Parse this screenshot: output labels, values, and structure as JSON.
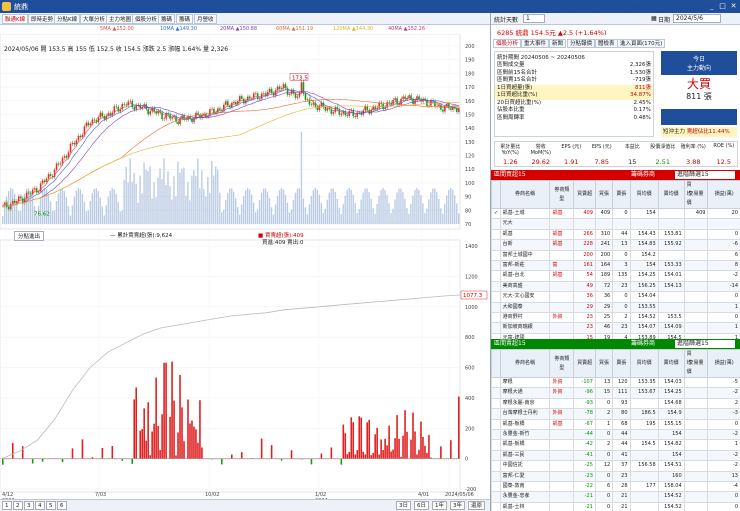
{
  "title": "統鼎",
  "window_buttons": [
    "_",
    "□",
    "✕"
  ],
  "left_tabs": [
    "聯通K線",
    "即時走勢",
    "分點K線",
    "大單分析",
    "主力地圖",
    "個股分析",
    "籌碼",
    "籌碼",
    "月營收"
  ],
  "ma_legend": [
    "5MA ▲152.00",
    "10MA ▲149.30",
    "20MA ▲150.88",
    "60MA ▲151.19",
    "120MA ▲144.30",
    "240MA",
    "40MA ▲152.26"
  ],
  "ma_colors": [
    "#e05050",
    "#3070d0",
    "#8040c0",
    "#e07030",
    "#e0b030",
    "#40a040",
    "#c03080"
  ],
  "price_info": {
    "line1": "2024/05/06 開 153.5 高 155 低 152.5 收 154.5 漲跌 2.5 漲幅 1.64% 量 2,326",
    "price_max_label": "173.5",
    "price_min_label": "76.62",
    "sub_price_label": "1077.3"
  },
  "y_axis_price": [
    "200",
    "190",
    "180",
    "170",
    "160",
    "150",
    "140",
    "130",
    "120",
    "110",
    "100",
    "90",
    "80",
    "70"
  ],
  "y_axis_sub": [
    "1400",
    "1200",
    "1000",
    "800",
    "600",
    "400",
    "200",
    "0",
    "-200"
  ],
  "x_axis": [
    "4/12\n2023",
    "7/03",
    "10/02",
    "1/02\n2024",
    "4/01",
    "2024/05/06"
  ],
  "sub_toolbar": {
    "select": "分點進出",
    "legend1": "— 累計賈賣超(張):9,624",
    "legend2": "■ 賈賣超(張):409",
    "legend3": "買進:409 賣出:0"
  },
  "bottom_pages": [
    "1",
    "2",
    "3",
    "4",
    "5",
    "6"
  ],
  "bottom_periods": [
    "3日",
    "6日",
    "1年",
    "3年",
    "還原"
  ],
  "right_tabs": [
    "統計天數",
    "1",
    "日期",
    "2024/5/6"
  ],
  "top_menu": [
    "手機",
    "報告",
    "籌碼",
    "主力",
    "籌碼",
    "選股資料",
    "交易筆數",
    "助選資料"
  ],
  "stock_header": "6285 統鼎 154.5元 ▲2.5 (+1.64%)",
  "sub_tabs": [
    "個股分析",
    "重大事件",
    "新聞",
    "分點報價",
    "體檢表",
    "進入頁面(170元)"
  ],
  "stats": {
    "period": "統計期間 20240506 ~ 20240506",
    "rows": [
      {
        "label": "區間成交量",
        "value": "2,326張"
      },
      {
        "label": "區間前15名合計",
        "value": "1,530張"
      },
      {
        "label": "區間賣15名合計",
        "value": "-719張"
      },
      {
        "label": "1日買超量(張)",
        "value": "811張"
      },
      {
        "label": "1日買超比重(%)",
        "value": "34.87%"
      },
      {
        "label": "20日買超比重(%)",
        "value": "2.45%"
      },
      {
        "label": "佔股本比重",
        "value": "0.17%"
      },
      {
        "label": "區間周轉率",
        "value": "0.48%"
      }
    ],
    "today_label": "今日",
    "main_force": "主力動向",
    "big_buy": "大買",
    "big_buy_qty": "811 張",
    "short_label": "短沖主力",
    "short_value": "賣超佔比11.44%"
  },
  "fund_heads": [
    "累計量比 YoY(%)",
    "營收 MoM(%)",
    "EPS (元)",
    "EPS (元)",
    "本益比",
    "股價淨值比",
    "殖利率 (%)",
    "ROE (%)"
  ],
  "fund_values": [
    "1.26",
    "29.62",
    "1.91",
    "7.85",
    "15",
    "2.51",
    "3.88",
    "12.5"
  ],
  "buy_section": {
    "title": "區間買超15",
    "select": "籌碼券商",
    "select2": "進階篩選15",
    "headers": [
      "",
      "券商名稱",
      "券商類型",
      "買賣超",
      "買張",
      "賣張",
      "買均價",
      "賣均價",
      "買均價",
      "交易量",
      "損益(萬)"
    ],
    "rows": [
      [
        "✓",
        "凱基-土城",
        "凱基",
        "409",
        "409",
        "0",
        "154",
        "",
        "",
        "409",
        "20"
      ],
      [
        "",
        "元大",
        "",
        "",
        "",
        "",
        "",
        "",
        "",
        "",
        ""
      ],
      [
        "",
        "凱基",
        "凱基",
        "266",
        "310",
        "44",
        "154.43",
        "153.81",
        "354",
        "",
        "0"
      ],
      [
        "",
        "台新",
        "凱基",
        "228",
        "241",
        "13",
        "154.83",
        "155.92",
        "254",
        "",
        "-6"
      ],
      [
        "",
        "富邦土城國中",
        "",
        "200",
        "200",
        "0",
        "154.2",
        "",
        "200",
        "",
        "6"
      ],
      [
        "",
        "富邦-新莊",
        "富",
        "161",
        "164",
        "3",
        "154",
        "153.33",
        "167",
        "",
        "8"
      ],
      [
        "",
        "凱基-台北",
        "凱基",
        "54",
        "189",
        "135",
        "154.25",
        "154.01",
        "324",
        "",
        "-2"
      ],
      [
        "",
        "美商高盛",
        "",
        "49",
        "72",
        "23",
        "156.25",
        "154.13",
        "95",
        "",
        "-14"
      ],
      [
        "",
        "元大-文心國安",
        "",
        "36",
        "36",
        "0",
        "154.04",
        "",
        "36",
        "",
        "0"
      ],
      [
        "",
        "大和國泰",
        "",
        "29",
        "29",
        "0",
        "153.55",
        "",
        "29",
        "",
        "1"
      ],
      [
        "",
        "港商野村",
        "外資",
        "23",
        "25",
        "2",
        "154.52",
        "153.5",
        "27",
        "",
        "0"
      ],
      [
        "",
        "新加坡商瑞銀",
        "",
        "23",
        "46",
        "23",
        "154.07",
        "154.09",
        "69",
        "",
        "1"
      ],
      [
        "",
        "元富-建國",
        "",
        "15",
        "19",
        "4",
        "153.89",
        "154.5",
        "23",
        "",
        "1"
      ],
      [
        "",
        "國泰-敦北",
        "",
        "15",
        "22",
        "7",
        "154.52",
        "154.29",
        "29",
        "",
        "0"
      ]
    ]
  },
  "sell_section": {
    "title": "區間賣超15",
    "select": "籌碼券商",
    "select2": "進階篩選15",
    "headers": [
      "",
      "券商名稱",
      "券商類型",
      "買賣超",
      "買張",
      "賣張",
      "買均價",
      "賣均價",
      "買均價",
      "交易量",
      "損益(萬)"
    ],
    "rows": [
      [
        "",
        "摩根",
        "外資",
        "-107",
        "13",
        "120",
        "153.35",
        "154.03",
        "133",
        "",
        "-5"
      ],
      [
        "",
        "摩根大通",
        "外資",
        "-96",
        "15",
        "111",
        "153.67",
        "154.25",
        "126",
        "",
        "-2"
      ],
      [
        "",
        "摩根永麗-南京",
        "",
        "-93",
        "0",
        "93",
        "",
        "154.68",
        "93",
        "",
        "2"
      ],
      [
        "",
        "台灣摩根士丹利",
        "外資",
        "-78",
        "2",
        "80",
        "186.5",
        "154.9",
        "82",
        "",
        "-3"
      ],
      [
        "",
        "凱基-板橋",
        "凱基",
        "-67",
        "1",
        "68",
        "195",
        "155.15",
        "69",
        "",
        "0"
      ],
      [
        "",
        "永豐金-新竹",
        "",
        "-44",
        "0",
        "44",
        "",
        "154",
        "44",
        "",
        "-2"
      ],
      [
        "",
        "凱基-板橋",
        "",
        "-42",
        "2",
        "44",
        "154.5",
        "154.82",
        "46",
        "",
        "1"
      ],
      [
        "",
        "凱基-三民",
        "",
        "-41",
        "0",
        "41",
        "",
        "154",
        "41",
        "",
        "-2"
      ],
      [
        "",
        "中國信託",
        "",
        "-25",
        "12",
        "37",
        "156.58",
        "154.51",
        "49",
        "",
        "-2"
      ],
      [
        "",
        "富邦-仁愛",
        "",
        "-23",
        "0",
        "23",
        "",
        "160",
        "23",
        "",
        "13"
      ],
      [
        "",
        "國泰-敦南",
        "",
        "-22",
        "6",
        "28",
        "177",
        "158.04",
        "34",
        "",
        "-4"
      ],
      [
        "",
        "永豐金-忠孝",
        "",
        "-21",
        "0",
        "21",
        "",
        "154.52",
        "21",
        "",
        "0"
      ],
      [
        "",
        "凱基-士林",
        "",
        "-21",
        "0",
        "21",
        "",
        "154.52",
        "21",
        "",
        "0"
      ]
    ]
  },
  "chart_data": {
    "type": "bar",
    "title": "",
    "x_labels": [
      "4/12",
      "7/03",
      "10/02",
      "1/02",
      "4/01",
      "2024/05/06"
    ],
    "price_range": [
      70,
      200
    ],
    "sub_range": [
      -200,
      1400
    ],
    "price_close_approx": [
      82,
      88,
      96,
      110,
      128,
      145,
      150,
      158,
      155,
      150,
      146,
      148,
      152,
      158,
      162,
      165,
      170,
      160,
      156,
      152,
      150,
      154,
      158,
      162,
      160,
      155,
      154.5
    ],
    "cumulative_buy_approx": [
      0,
      50,
      120,
      260,
      450,
      600,
      700,
      760,
      820,
      860,
      880,
      900,
      920,
      940,
      950,
      960,
      980,
      990,
      1000,
      1010,
      1020,
      1030,
      1040,
      1050,
      1060,
      1070,
      1077.3
    ],
    "last_bar_value": 409
  }
}
